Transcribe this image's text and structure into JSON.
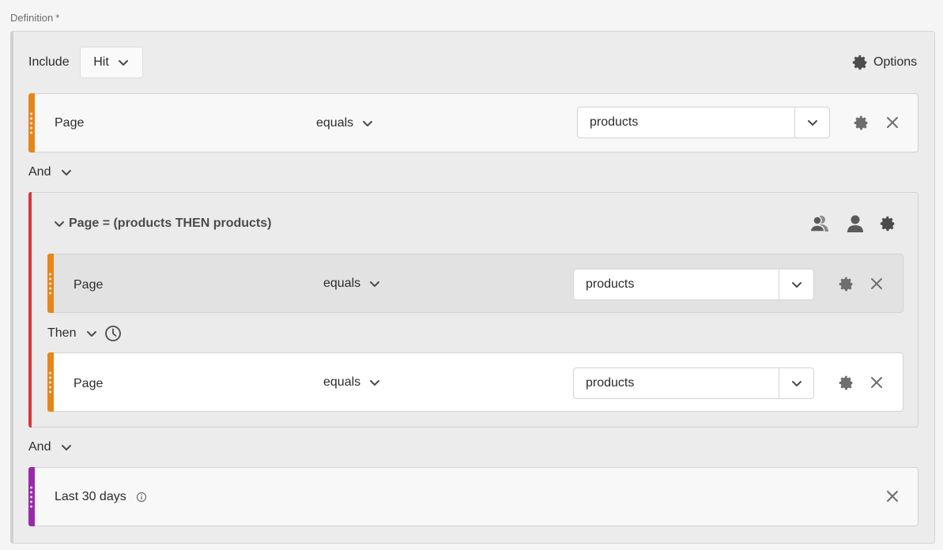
{
  "section": {
    "label": "Definition",
    "required_mark": "*"
  },
  "header": {
    "include_label": "Include",
    "scope_value": "Hit",
    "options_label": "Options"
  },
  "rule1": {
    "dimension": "Page",
    "operator": "equals",
    "value": "products"
  },
  "connector1": {
    "label": "And"
  },
  "container": {
    "title": "Page = (products THEN products)",
    "rule_a": {
      "dimension": "Page",
      "operator": "equals",
      "value": "products"
    },
    "then_label": "Then",
    "rule_b": {
      "dimension": "Page",
      "operator": "equals",
      "value": "products"
    }
  },
  "connector2": {
    "label": "And"
  },
  "date_rule": {
    "label": "Last 30 days"
  },
  "colors": {
    "dimension_bar": "#e68619",
    "date_bar": "#9a2aab",
    "container_bar": "#d7373f"
  },
  "icons": [
    "gear-icon",
    "close-icon",
    "chevron-down-icon",
    "users-icon",
    "user-icon",
    "clock-icon",
    "info-icon",
    "drag-handle-icon"
  ]
}
